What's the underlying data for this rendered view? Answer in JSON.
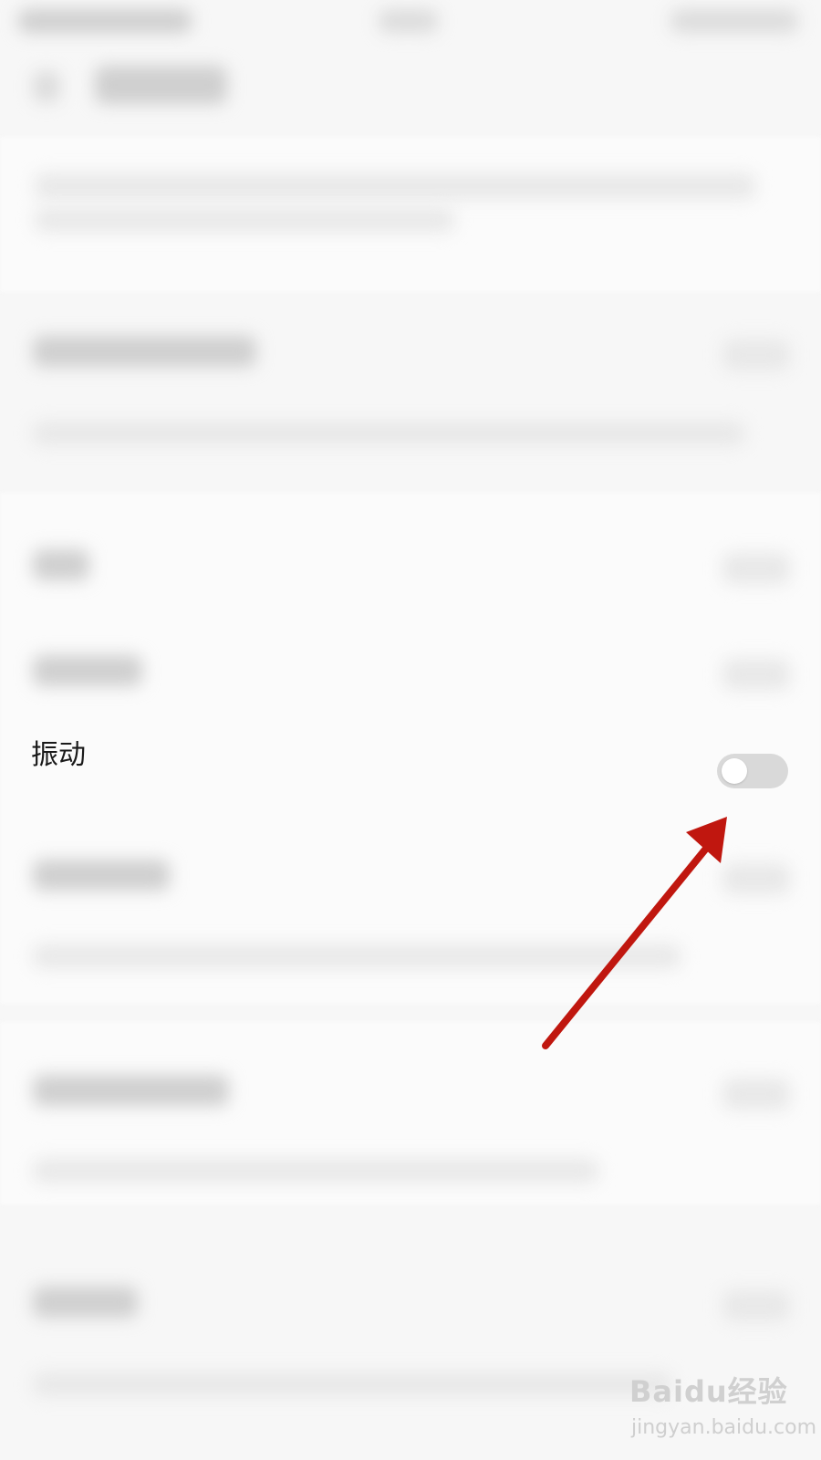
{
  "settings": {
    "vibration": {
      "label": "振动",
      "toggle_on": false
    }
  },
  "annotation": {
    "color": "#c0170f"
  },
  "watermark": {
    "brand": "Baidu经验",
    "url": "jingyan.baidu.com"
  }
}
